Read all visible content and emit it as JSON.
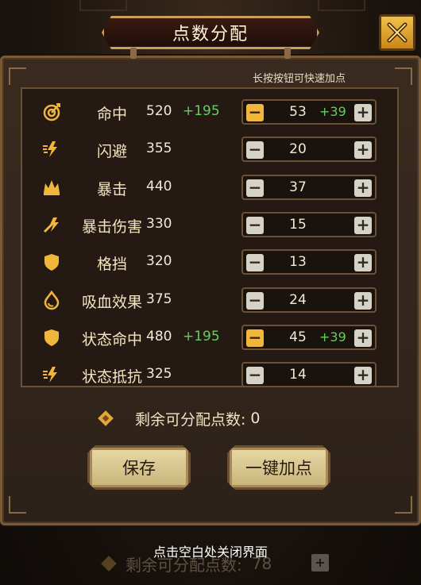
{
  "title": "点数分配",
  "hint_long_press": "长按按钮可快速加点",
  "colors": {
    "bonus_green": "#5fd25a",
    "accent_gold": "#f0b73a",
    "frame_brown": "#7a5a35"
  },
  "stats": [
    {
      "name": "命中",
      "icon": "target-icon",
      "value": "520",
      "bonus": "+195",
      "points": "53",
      "points_bonus": "+39",
      "minus_active": true
    },
    {
      "name": "闪避",
      "icon": "dodge-icon",
      "value": "355",
      "bonus": "",
      "points": "20",
      "points_bonus": "",
      "minus_active": false
    },
    {
      "name": "暴击",
      "icon": "crit-icon",
      "value": "440",
      "bonus": "",
      "points": "37",
      "points_bonus": "",
      "minus_active": false
    },
    {
      "name": "暴击伤害",
      "icon": "crit-damage-icon",
      "value": "330",
      "bonus": "",
      "points": "15",
      "points_bonus": "",
      "minus_active": false
    },
    {
      "name": "格挡",
      "icon": "shield-icon",
      "value": "320",
      "bonus": "",
      "points": "13",
      "points_bonus": "",
      "minus_active": false
    },
    {
      "name": "吸血效果",
      "icon": "blood-drop-icon",
      "value": "375",
      "bonus": "",
      "points": "24",
      "points_bonus": "",
      "minus_active": false
    },
    {
      "name": "状态命中",
      "icon": "shield-icon",
      "value": "480",
      "bonus": "+195",
      "points": "45",
      "points_bonus": "+39",
      "minus_active": true
    },
    {
      "name": "状态抵抗",
      "icon": "dodge-icon",
      "value": "325",
      "bonus": "",
      "points": "14",
      "points_bonus": "",
      "minus_active": false
    }
  ],
  "remaining": {
    "label": "剩余可分配点数:",
    "value": "0"
  },
  "buttons": {
    "save": "保存",
    "auto_allocate": "一键加点"
  },
  "close_hint": "点击空白处关闭界面",
  "background_row": {
    "label": "剩余可分配点数:",
    "value": "78"
  }
}
